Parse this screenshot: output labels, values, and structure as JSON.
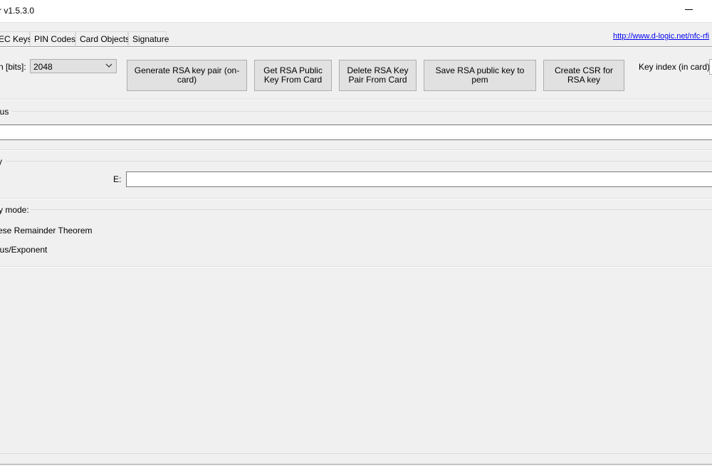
{
  "window": {
    "title": "r v1.5.3.0"
  },
  "tabs": [
    {
      "label": "EC Keys"
    },
    {
      "label": "PIN Codes"
    },
    {
      "label": "Card Objects"
    },
    {
      "label": "Signature"
    }
  ],
  "link": {
    "text": "http://www.d-logic.net/nfc-rfi"
  },
  "key_length": {
    "label": "n [bits]:",
    "value": "2048"
  },
  "buttons": {
    "generate": "Generate RSA key pair (on-card)",
    "get_public": "Get RSA Public Key From Card",
    "delete_pair": "Delete RSA Key Pair From Card",
    "save_pem": "Save RSA public key to pem",
    "create_csr": "Create CSR for RSA key"
  },
  "key_index": {
    "label": "Key index (in card):"
  },
  "modulus": {
    "label": "lus",
    "value": ""
  },
  "exponent_group": {
    "label": "y"
  },
  "exponent": {
    "label": "E:",
    "value": ""
  },
  "mode_group": {
    "label": "y mode:",
    "options": [
      {
        "label": "ese Remainder Theorem"
      },
      {
        "label": "lus/Exponent"
      }
    ]
  }
}
